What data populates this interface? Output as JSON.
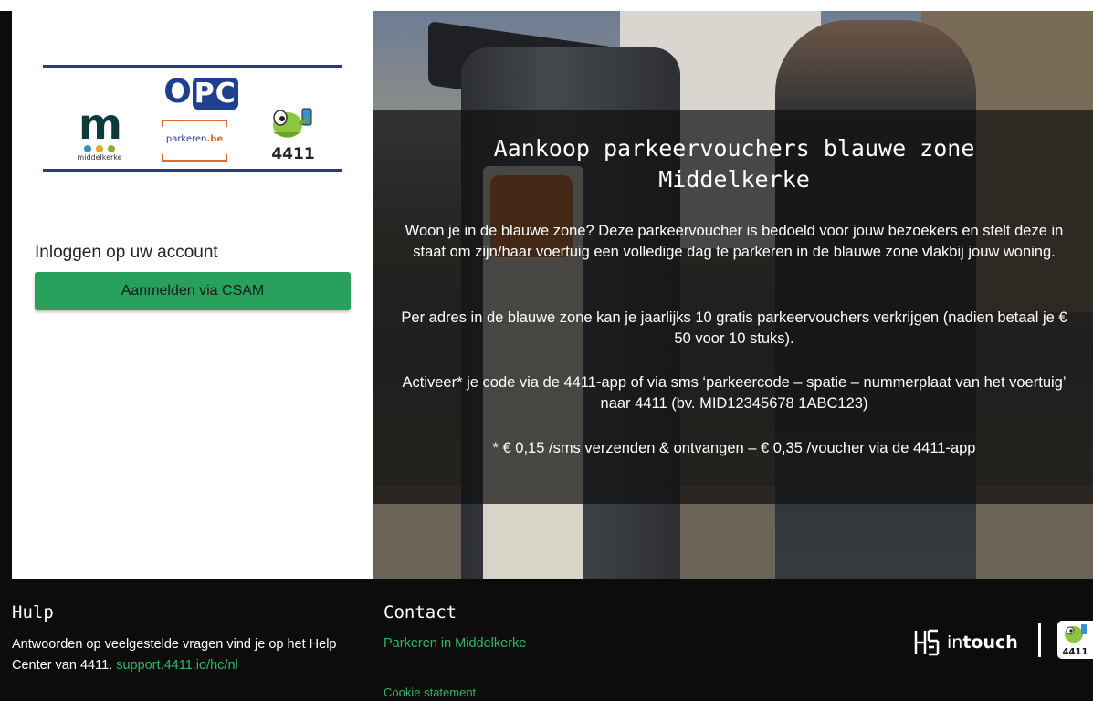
{
  "logos": {
    "opc": "O",
    "opc_box": "PC",
    "middelkerke_letter": "m",
    "middelkerke_name": "middelkerke",
    "parkeren": "parkeren",
    "parkeren_dot": ".be",
    "brand_number": "4411"
  },
  "login": {
    "title": "Inloggen op uw account",
    "csam_button": "Aanmelden via CSAM"
  },
  "hero": {
    "title": "Aankoop parkeervouchers blauwe zone Middelkerke",
    "paragraph_1": "Woon je in de blauwe zone? Deze parkeervoucher is bedoeld voor jouw bezoekers en stelt deze in staat om zijn/haar voertuig een volledige dag te parkeren in de blauwe zone vlakbij jouw woning.",
    "paragraph_2": "Per adres in de blauwe zone kan je jaarlijks 10 gratis parkeervouchers verkrijgen (nadien betaal je € 50 voor 10 stuks).",
    "paragraph_3": "Activeer* je code via de 4411-app of via sms ‘parkeercode – spatie – nummerplaat van het voertuig’ naar 4411 (bv. MID12345678 1ABC123)",
    "paragraph_4": "* € 0,15 /sms verzenden & ontvangen – € 0,35 /voucher via de 4411-app"
  },
  "footer": {
    "help_title": "Hulp",
    "help_text": "Antwoorden op veelgestelde vragen vind je op het Help Center van 4411.",
    "help_link": "support.4411.io/hc/nl",
    "contact_title": "Contact",
    "contact_link": "Parkeren in Middelkerke",
    "cookie_link": "Cookie statement",
    "intouch_light": "in",
    "intouch_bold": "touch",
    "badge_number": "4411"
  },
  "colors": {
    "accent_green": "#26a05a",
    "link_green": "#2fb66a",
    "footer_bg": "#0c0c0c",
    "logo_navy": "#2b3a7a",
    "parkeren_orange": "#e06c2f"
  }
}
